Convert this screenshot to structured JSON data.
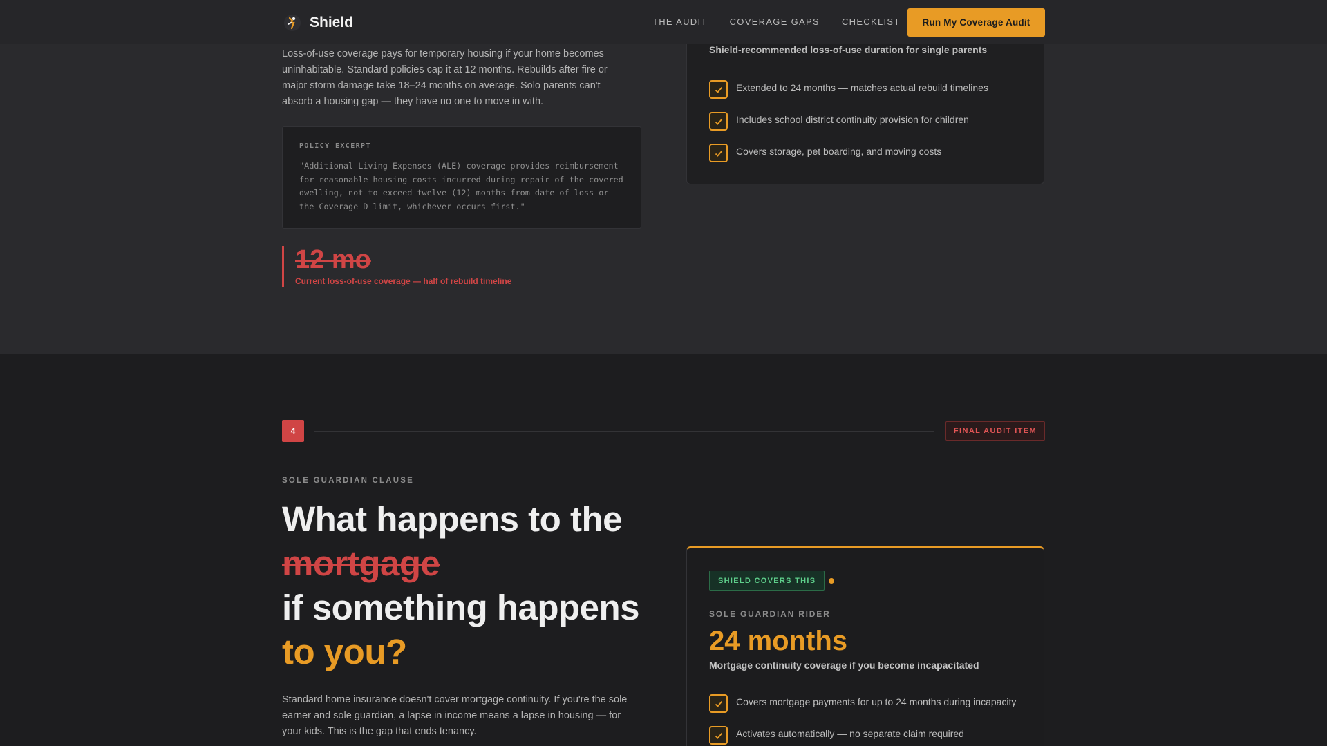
{
  "nav": {
    "brand": "Shield",
    "links": [
      "THE AUDIT",
      "COVERAGE GAPS",
      "CHECKLIST"
    ],
    "cta": "Run My Coverage Audit"
  },
  "loss_of_use": {
    "body": "Loss-of-use coverage pays for temporary housing if your home becomes uninhabitable. Standard policies cap it at 12 months. Rebuilds after fire or major storm damage take 18–24 months on average. Solo parents can't absorb a housing gap — they have no one to move in with.",
    "excerpt_label": "POLICY EXCERPT",
    "excerpt_text": "\"Additional Living Expenses (ALE) coverage provides reimbursement for reasonable housing costs incurred during repair of the covered dwelling, not to exceed twelve (12) months from date of loss or the Coverage D limit, whichever occurs first.\"",
    "stat_value": "12 mo",
    "stat_caption": "Current loss-of-use coverage — half of rebuild timeline",
    "card_title": "Shield-recommended loss-of-use duration for single parents",
    "checks": [
      "Extended to 24 months — matches actual rebuild timelines",
      "Includes school district continuity provision for children",
      "Covers storage, pet boarding, and moving costs"
    ]
  },
  "sole_guardian": {
    "number": "4",
    "final_tag": "FINAL AUDIT ITEM",
    "eyebrow": "SOLE GUARDIAN CLAUSE",
    "headline_1": "What happens to the",
    "headline_strike": "mortgage",
    "headline_3": "if something happens",
    "headline_accent": "to you?",
    "body": "Standard home insurance doesn't cover mortgage continuity. If you're the sole earner and sole guardian, a lapse in income means a lapse in housing — for your kids. This is the gap that ends tenancy.",
    "covers_tag": "SHIELD COVERS THIS",
    "rider_label": "SOLE GUARDIAN RIDER",
    "rider_value": "24 months",
    "rider_sub": "Mortgage continuity coverage if you become incapacitated",
    "checks": [
      "Covers mortgage payments for up to 24 months during incapacity",
      "Activates automatically — no separate claim required"
    ]
  },
  "colors": {
    "accent": "#e89b25",
    "danger": "#d04545",
    "success": "#5fd08c"
  },
  "icons": {
    "brand": "shield-figure-icon",
    "check": "check-icon"
  }
}
